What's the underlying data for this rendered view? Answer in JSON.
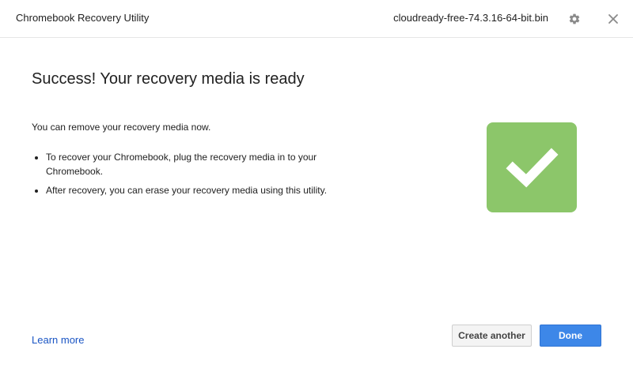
{
  "titlebar": {
    "app_title": "Chromebook Recovery Utility",
    "file_name": "cloudready-free-74.3.16-64-bit.bin",
    "settings_icon": "gear-icon",
    "close_icon": "close-icon"
  },
  "main": {
    "heading": "Success! Your recovery media is ready",
    "intro": "You can remove your recovery media now.",
    "bullets": [
      "To recover your Chromebook, plug the recovery media in to your Chromebook.",
      "After recovery, you can erase your recovery media using this utility."
    ],
    "status_icon": "checkmark-icon"
  },
  "footer": {
    "learn_more": "Learn more",
    "create_another": "Create another",
    "done": "Done"
  },
  "colors": {
    "success_green": "#8cc66a",
    "primary_blue": "#3d87e8",
    "link_blue": "#1a55c4"
  }
}
